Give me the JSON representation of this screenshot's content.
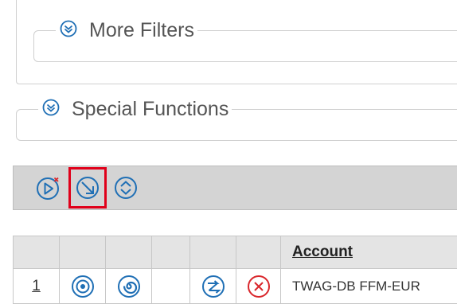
{
  "filters": {
    "more_filters_label": "More Filters",
    "special_functions_label": "Special Functions"
  },
  "toolbar": {
    "buttons": [
      {
        "icon": "play-stop-icon"
      },
      {
        "icon": "arrow-down-right-icon",
        "selected": true
      },
      {
        "icon": "expand-collapse-icon"
      }
    ]
  },
  "table": {
    "headers": [
      "",
      "",
      "",
      "",
      "",
      "",
      "Account"
    ],
    "rows": [
      {
        "number": "1",
        "icons": [
          "target-icon",
          "spiral-icon",
          "",
          "transfer-icon",
          "cancel-icon"
        ],
        "account": "TWAG-DB FFM-EUR"
      }
    ]
  },
  "colors": {
    "icon_blue": "#1f6fb5",
    "cancel_red": "#d9262b",
    "selection_red": "#e0001a",
    "toolbar_bg": "#d4d4d4",
    "header_bg": "#e4e4e4"
  }
}
